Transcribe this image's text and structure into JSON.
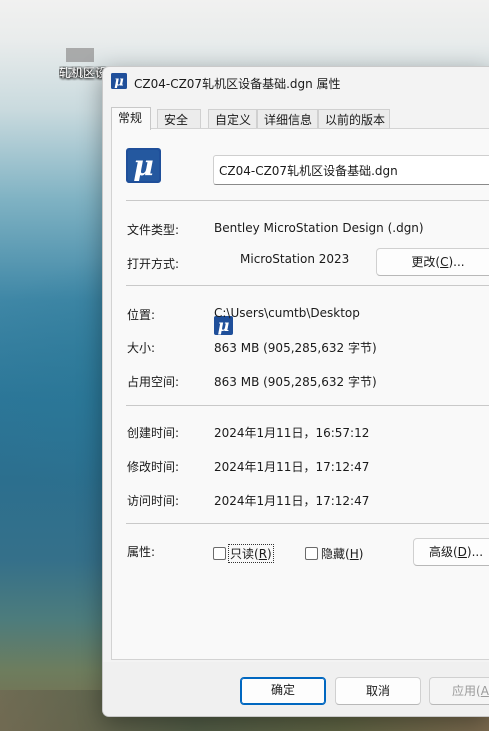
{
  "desktop": {
    "icon_label_line1": "CZ04-CZ07",
    "icon_label_line2": "轧机区设备基础"
  },
  "window": {
    "title": "CZ04-CZ07轧机区设备基础.dgn 属性",
    "app_icon": "microstation-icon"
  },
  "tabs": [
    {
      "label": "常规",
      "active": true
    },
    {
      "label": "安全"
    },
    {
      "label": "自定义"
    },
    {
      "label": "详细信息"
    },
    {
      "label": "以前的版本"
    }
  ],
  "general": {
    "file_name": "CZ04-CZ07轧机区设备基础.dgn",
    "file_type_label": "文件类型:",
    "file_type_value": "Bentley MicroStation Design (.dgn)",
    "opens_with_label": "打开方式:",
    "opens_with_value": "MicroStation 2023",
    "change_button": "更改(C)...",
    "change_button_pre": "更改(",
    "change_button_key": "C",
    "change_button_post": ")...",
    "location_label": "位置:",
    "location_value": "C:\\Users\\cumtb\\Desktop",
    "size_label": "大小:",
    "size_value": "863 MB (905,285,632 字节)",
    "size_on_disk_label": "占用空间:",
    "size_on_disk_value": "863 MB (905,285,632 字节)",
    "created_label": "创建时间:",
    "created_value": "2024年1月11日，16:57:12",
    "modified_label": "修改时间:",
    "modified_value": "2024年1月11日，17:12:47",
    "accessed_label": "访问时间:",
    "accessed_value": "2024年1月11日，17:12:47",
    "attributes_label": "属性:",
    "readonly_pre": "只读(",
    "readonly_key": "R",
    "readonly_post": ")",
    "hidden_pre": "隐藏(",
    "hidden_key": "H",
    "hidden_post": ")",
    "readonly_checked": false,
    "hidden_checked": false,
    "advanced_pre": "高级(",
    "advanced_key": "D",
    "advanced_post": ")..."
  },
  "footer": {
    "ok": "确定",
    "cancel": "取消",
    "apply_pre": "应用(",
    "apply_key": "A",
    "apply_post": ")"
  },
  "colors": {
    "accent": "#0067c0",
    "microstation_blue": "#1f4f9a"
  }
}
